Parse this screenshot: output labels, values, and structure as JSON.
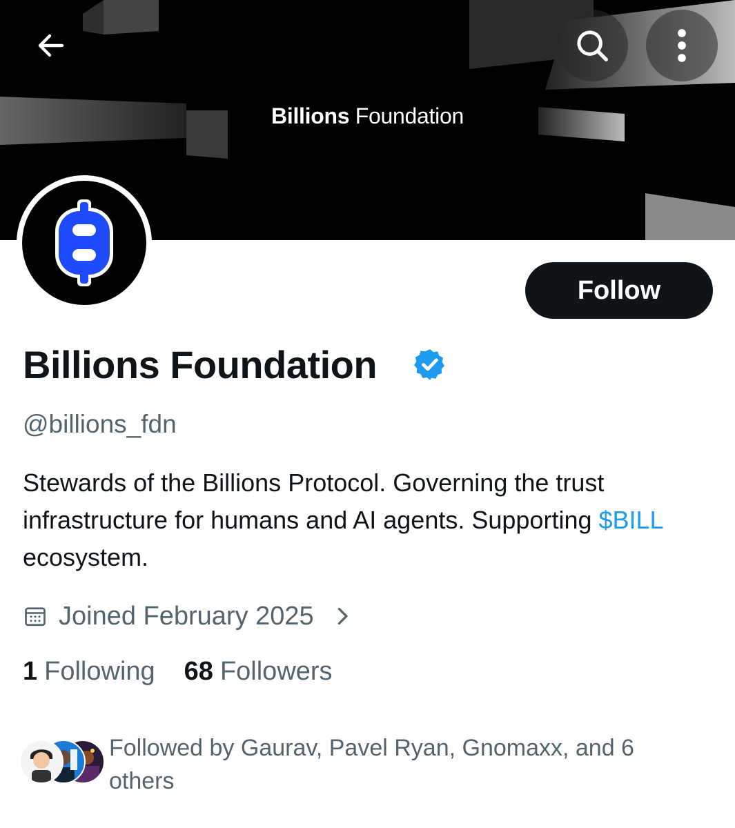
{
  "banner": {
    "title_bold": "Billions",
    "title_regular": " Foundation"
  },
  "profile": {
    "display_name": "Billions Foundation",
    "handle": "@billions_fdn",
    "bio_text": "Stewards of the Billions Protocol. Governing the trust infrastructure for humans and AI agents. Supporting ",
    "bio_cashtag": "$BILL",
    "bio_suffix": " ecosystem.",
    "joined": "Joined February 2025",
    "following_count": "1",
    "following_label": "Following",
    "followers_count": "68",
    "followers_label": "Followers",
    "followed_by": "Followed by Gaurav, Pavel Ryan, Gnomaxx, and 6 others"
  },
  "actions": {
    "follow_label": "Follow"
  },
  "colors": {
    "accent": "#1d9bf0",
    "text": "#0f1419",
    "muted": "#536471",
    "avatar_logo": "#1f4bff"
  },
  "icons": [
    "back-arrow-icon",
    "search-icon",
    "more-vertical-icon",
    "verified-badge-icon",
    "calendar-icon",
    "chevron-right-icon"
  ]
}
